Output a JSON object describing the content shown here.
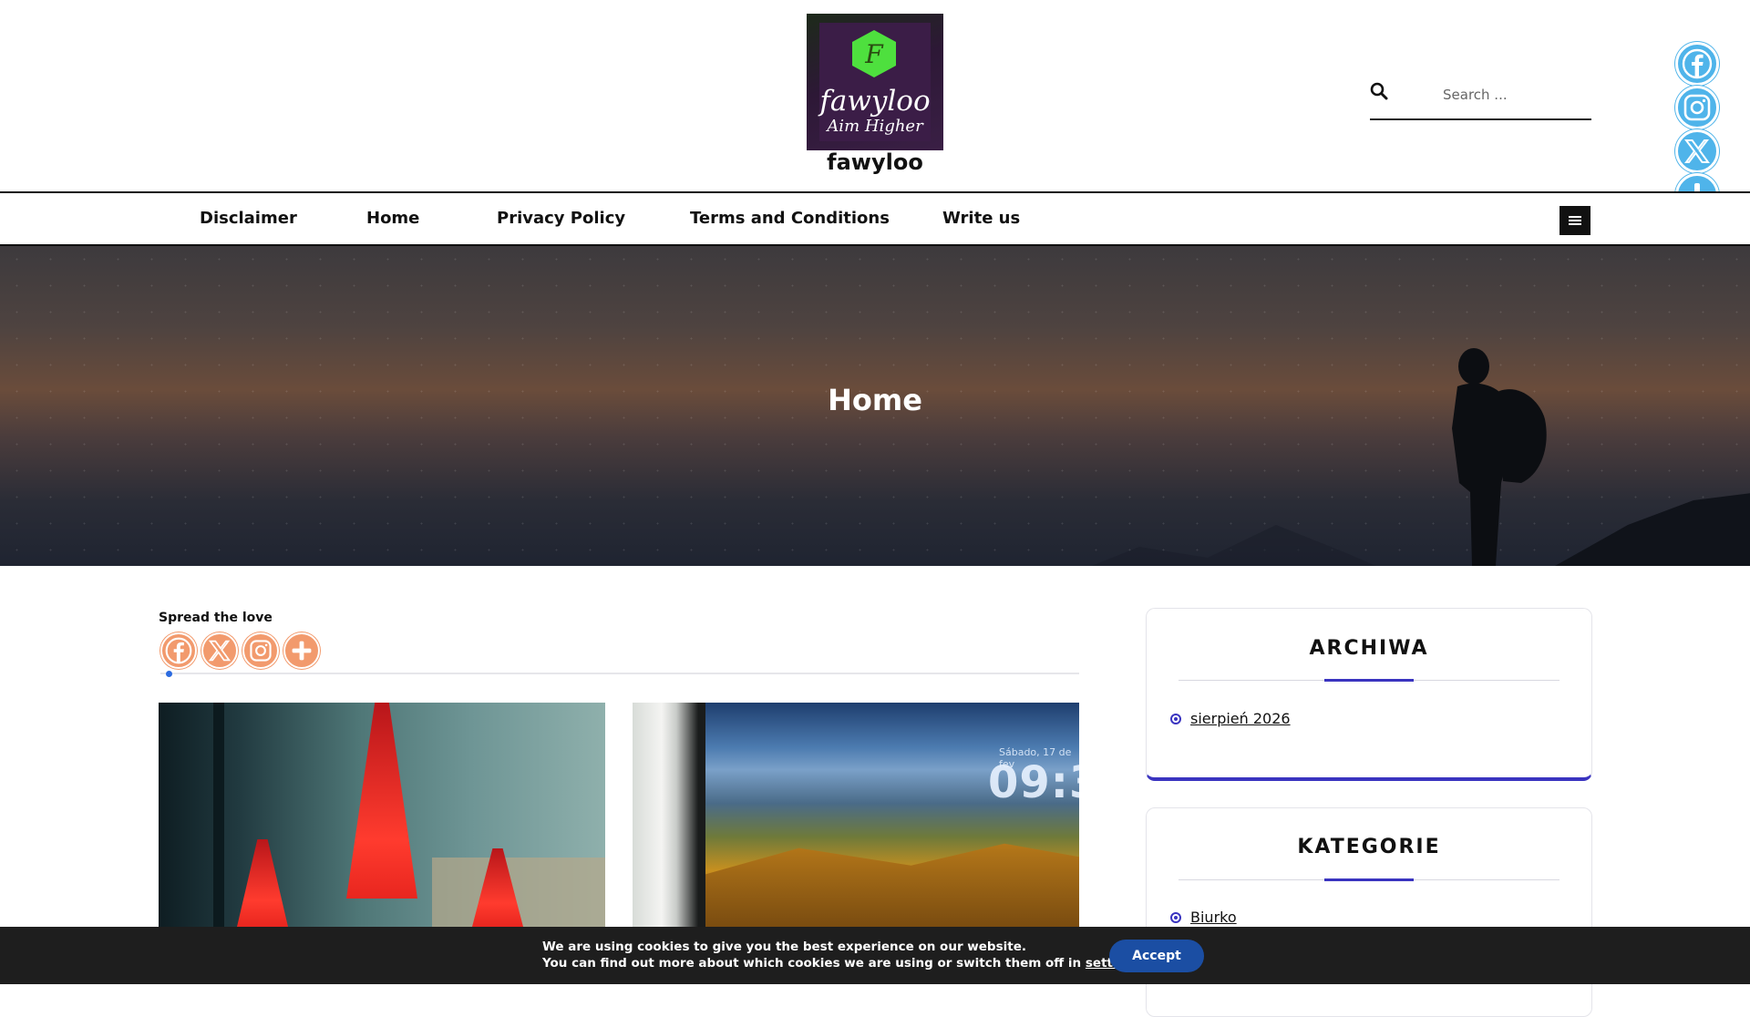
{
  "site": {
    "logo_word": "fawyloo",
    "logo_tagline": "Aim Higher",
    "logo_letter": "F",
    "title": "fawyloo"
  },
  "search": {
    "placeholder": "Search ..."
  },
  "nav": {
    "items": [
      {
        "label": "Disclaimer"
      },
      {
        "label": "Home"
      },
      {
        "label": "Privacy Policy"
      },
      {
        "label": "Terms and Conditions"
      },
      {
        "label": "Write us"
      }
    ]
  },
  "float_share": {
    "icons": [
      "facebook-icon",
      "instagram-icon",
      "x-icon",
      "plus-icon"
    ],
    "color": "#4fb4ea"
  },
  "hero": {
    "title": "Home"
  },
  "share": {
    "label": "Spread the love",
    "icons": [
      "facebook-icon",
      "x-icon",
      "instagram-icon",
      "plus-icon"
    ],
    "color": "#f29a6d"
  },
  "posts": [
    {
      "image": "red-pendant-lamps"
    },
    {
      "image": "landscape-screen-clock",
      "clock": "09:3",
      "date": "Sábado, 17 de fev"
    }
  ],
  "sidebar": {
    "archive": {
      "title": "ARCHIWA",
      "items": [
        "sierpień 2026"
      ]
    },
    "categories": {
      "title": "KATEGORIE",
      "items": [
        "Biurko"
      ]
    },
    "accent": "#3a34c0"
  },
  "cookie": {
    "line1": "We are using cookies to give you the best experience on our website.",
    "line2_prefix": "You can find out more about which cookies we are using or switch them off in ",
    "settings_link": "settings",
    "line2_suffix": ".",
    "accept": "Accept"
  }
}
